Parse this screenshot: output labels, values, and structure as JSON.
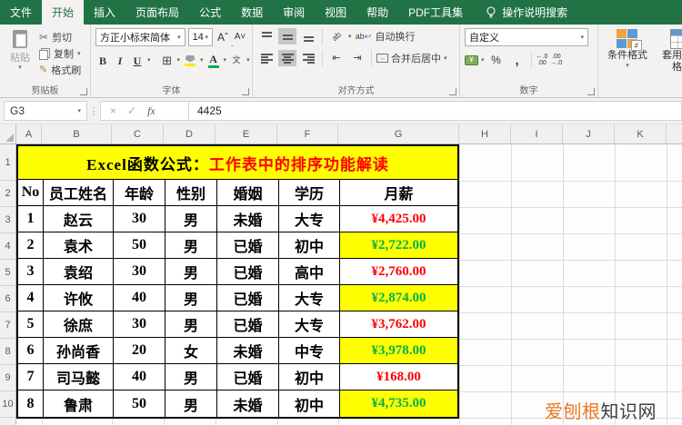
{
  "menu": {
    "tabs": [
      {
        "label": "文件",
        "type": "file"
      },
      {
        "label": "开始",
        "active": true
      },
      {
        "label": "插入"
      },
      {
        "label": "页面布局"
      },
      {
        "label": "公式"
      },
      {
        "label": "数据"
      },
      {
        "label": "审阅"
      },
      {
        "label": "视图"
      },
      {
        "label": "帮助"
      },
      {
        "label": "PDF工具集"
      }
    ],
    "search_label": "操作说明搜索"
  },
  "ribbon": {
    "clipboard": {
      "group_label": "剪贴板",
      "paste": "粘贴",
      "cut": "剪切",
      "copy": "复制",
      "format_painter": "格式刷"
    },
    "font": {
      "group_label": "字体",
      "font_name": "方正小标宋简体",
      "font_size": "14",
      "bold": "B",
      "italic": "I",
      "underline": "U",
      "grow": "A",
      "shrink": "A",
      "color_letter": "A",
      "pinyin": "文"
    },
    "alignment": {
      "group_label": "对齐方式",
      "wrap_text": "自动换行",
      "merge_center": "合并后居中",
      "orient": "ab"
    },
    "number": {
      "group_label": "数字",
      "format": "自定义",
      "currency": "¥",
      "percent": "%",
      "comma": ",",
      "inc_dec_top": "←.0",
      "inc_dec_bottom": ".00",
      "dec_dec_top": ".00",
      "dec_dec_bottom": "→.0"
    },
    "styles": {
      "conditional_format": "条件格式",
      "format_as_table": "套用表格格式",
      "neq": "≠"
    }
  },
  "formula_bar": {
    "name_box": "G3",
    "cancel": "×",
    "enter": "✓",
    "fx": "fx",
    "value": "4425"
  },
  "sheet": {
    "column_letters": [
      "A",
      "B",
      "C",
      "D",
      "E",
      "F",
      "G",
      "H",
      "I",
      "J",
      "K"
    ],
    "row_numbers": [
      "1",
      "2",
      "3",
      "4",
      "5",
      "6",
      "7",
      "8",
      "9",
      "10"
    ],
    "title": {
      "black": "Excel函数公式：",
      "red": "工作表中的排序功能解读"
    },
    "headers": [
      "No",
      "员工姓名",
      "年龄",
      "性别",
      "婚姻",
      "学历",
      "月薪"
    ],
    "rows": [
      {
        "no": "1",
        "name": "赵云",
        "age": "30",
        "gender": "男",
        "marital": "未婚",
        "education": "大专",
        "salary": "¥4,425.00",
        "salary_style": "red"
      },
      {
        "no": "2",
        "name": "袁术",
        "age": "50",
        "gender": "男",
        "marital": "已婚",
        "education": "初中",
        "salary": "¥2,722.00",
        "salary_style": "green-yellow"
      },
      {
        "no": "3",
        "name": "袁绍",
        "age": "30",
        "gender": "男",
        "marital": "已婚",
        "education": "高中",
        "salary": "¥2,760.00",
        "salary_style": "red"
      },
      {
        "no": "4",
        "name": "许攸",
        "age": "40",
        "gender": "男",
        "marital": "已婚",
        "education": "大专",
        "salary": "¥2,874.00",
        "salary_style": "green-yellow"
      },
      {
        "no": "5",
        "name": "徐庶",
        "age": "30",
        "gender": "男",
        "marital": "已婚",
        "education": "大专",
        "salary": "¥3,762.00",
        "salary_style": "red"
      },
      {
        "no": "6",
        "name": "孙尚香",
        "age": "20",
        "gender": "女",
        "marital": "未婚",
        "education": "中专",
        "salary": "¥3,978.00",
        "salary_style": "green-yellow"
      },
      {
        "no": "7",
        "name": "司马懿",
        "age": "40",
        "gender": "男",
        "marital": "已婚",
        "education": "初中",
        "salary": "¥168.00",
        "salary_style": "red"
      },
      {
        "no": "8",
        "name": "鲁肃",
        "age": "50",
        "gender": "男",
        "marital": "未婚",
        "education": "初中",
        "salary": "¥4,735.00",
        "salary_style": "green-yellow"
      }
    ]
  },
  "watermark": {
    "orange": "爱刨根",
    "dark": "知识网"
  },
  "colors": {
    "excel_green": "#217346",
    "banner_yellow": "#ffff00",
    "salary_red": "#ff0000",
    "salary_green": "#00b050",
    "highlight_yellow": "#ffff00",
    "watermark_orange": "#e87722"
  }
}
